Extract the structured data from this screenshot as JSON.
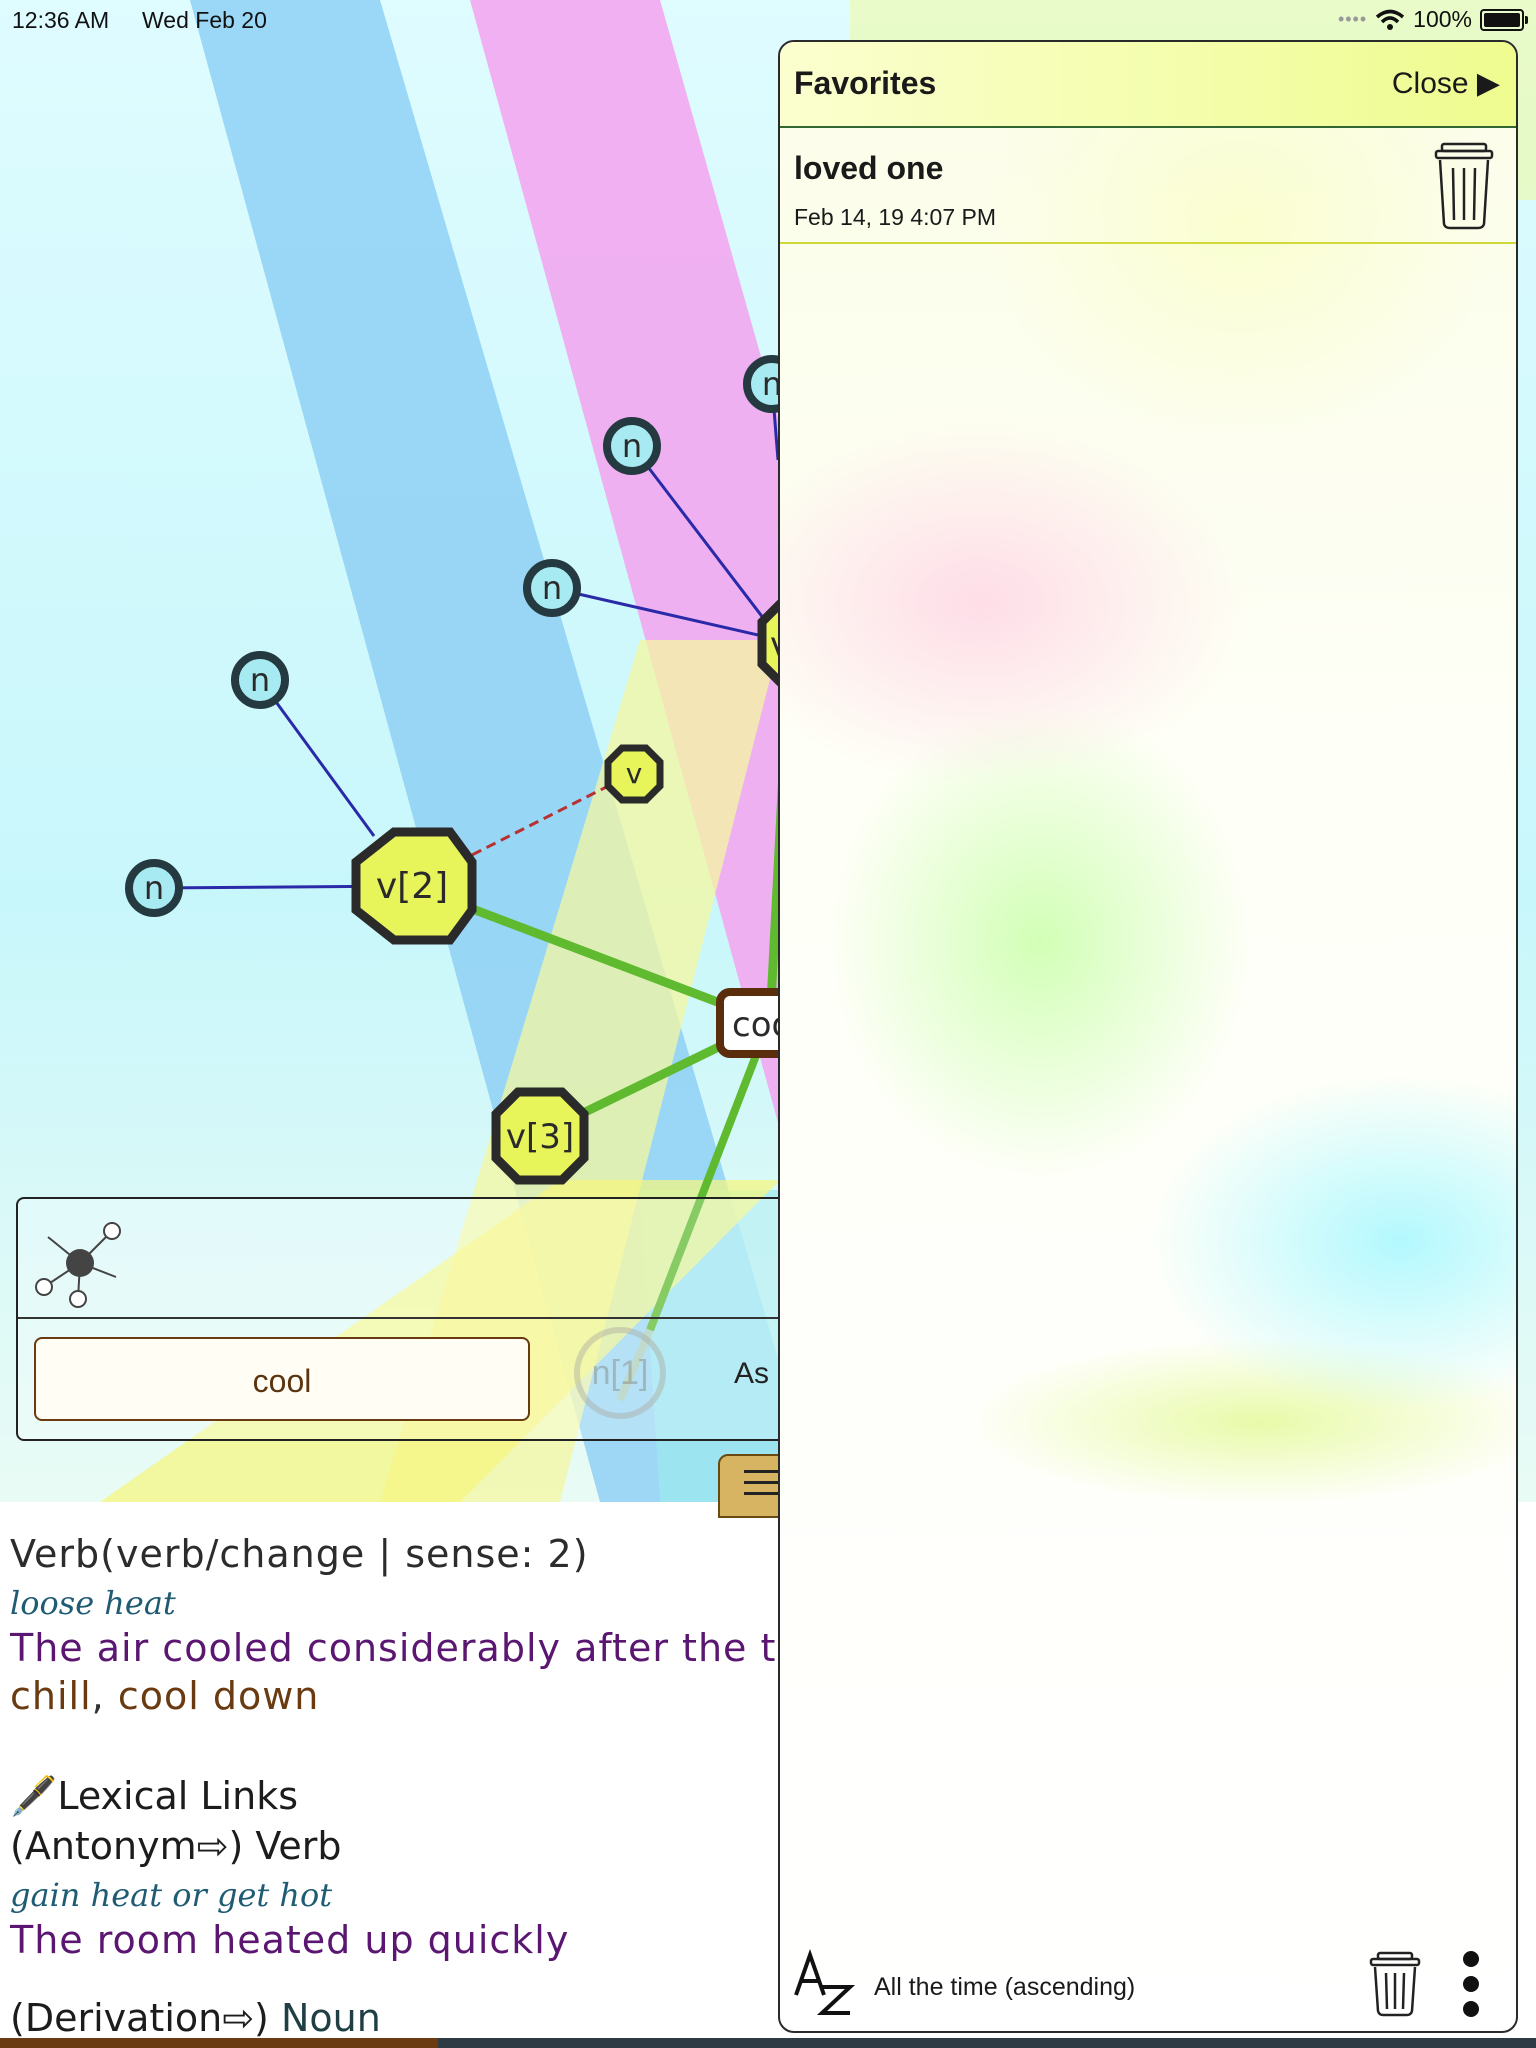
{
  "status_bar": {
    "time": "12:36 AM",
    "date": "Wed Feb 20",
    "battery": "100%"
  },
  "graph": {
    "center_node": "cool",
    "nodes": [
      {
        "id": "v2",
        "label": "v[2]",
        "kind": "verb-large"
      },
      {
        "id": "v3",
        "label": "v[3]",
        "kind": "verb-large"
      },
      {
        "id": "v-small",
        "label": "v",
        "kind": "verb-small"
      },
      {
        "id": "v-partial",
        "label": "v",
        "kind": "verb-large"
      },
      {
        "id": "n1",
        "label": "n",
        "kind": "noun"
      },
      {
        "id": "n2",
        "label": "n",
        "kind": "noun"
      },
      {
        "id": "n3",
        "label": "n",
        "kind": "noun"
      },
      {
        "id": "n4",
        "label": "n",
        "kind": "noun"
      },
      {
        "id": "n5",
        "label": "n",
        "kind": "noun"
      }
    ],
    "colors": {
      "verb_fill": "#e8f55a",
      "noun_fill": "#a8eaf2",
      "node_border": "#2a2a2a",
      "center_border": "#5a2d0c",
      "main_edge": "#5fba30",
      "lexical_edge": "#2a2aa8",
      "antonym_edge": "#b83030"
    }
  },
  "toolbar": {
    "word": "cool",
    "ghost_node": "n[1]",
    "as_label": "As"
  },
  "definition": {
    "pos": "Verb(verb/change | sense: 2)",
    "gloss": "loose heat",
    "example": "The air cooled considerably after the t",
    "synonyms": [
      "chill",
      "cool down"
    ],
    "lexical_heading": "🖋️Lexical Links",
    "antonym_label": "(Antonym⇨) Verb",
    "antonym_gloss": "gain heat or get hot",
    "antonym_example": "The room heated up quickly",
    "derivation_label": "(Derivation⇨)",
    "derivation_pos": "Noun"
  },
  "favorites": {
    "title": "Favorites",
    "close_label": "Close ▶",
    "items": [
      {
        "word": "loved one",
        "date": "Feb 14, 19 4:07 PM"
      }
    ],
    "sort_label": "All the time (ascending)",
    "accent_color": "#eefc8f"
  }
}
